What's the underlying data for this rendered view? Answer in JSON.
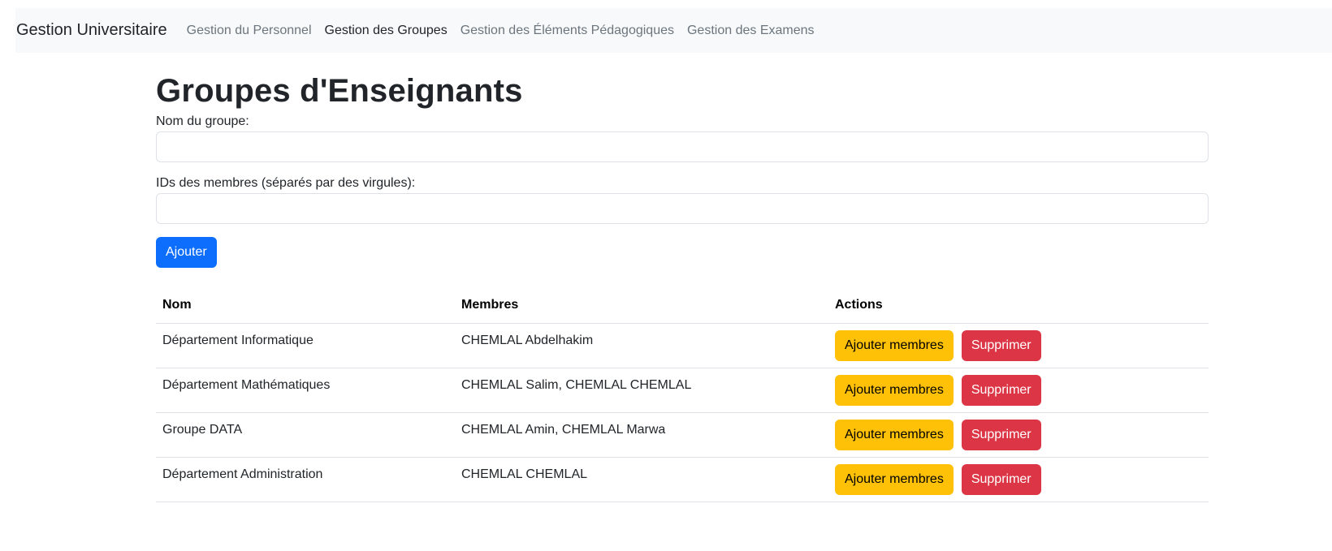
{
  "navbar": {
    "brand": "Gestion Universitaire",
    "links": [
      {
        "label": "Gestion du Personnel",
        "active": false
      },
      {
        "label": "Gestion des Groupes",
        "active": true
      },
      {
        "label": "Gestion des Éléments Pédagogiques",
        "active": false
      },
      {
        "label": "Gestion des Examens",
        "active": false
      }
    ]
  },
  "page": {
    "title": "Groupes d'Enseignants"
  },
  "form": {
    "name_label": "Nom du groupe:",
    "name_value": "",
    "members_label": "IDs des membres (séparés par des virgules):",
    "members_value": "",
    "submit_label": "Ajouter"
  },
  "table": {
    "headers": [
      "Nom",
      "Membres",
      "Actions"
    ],
    "rows": [
      {
        "nom": "Département Informatique",
        "membres": "CHEMLAL Abdelhakim"
      },
      {
        "nom": "Département Mathématiques",
        "membres": "CHEMLAL Salim, CHEMLAL CHEMLAL"
      },
      {
        "nom": "Groupe DATA",
        "membres": "CHEMLAL Amin, CHEMLAL Marwa"
      },
      {
        "nom": "Département Administration",
        "membres": "CHEMLAL CHEMLAL"
      }
    ],
    "add_members_label": "Ajouter membres",
    "delete_label": "Supprimer"
  },
  "colors": {
    "primary": "#0d6efd",
    "warning": "#ffc107",
    "danger": "#dc3545",
    "navbar_bg": "#f8f9fa"
  }
}
